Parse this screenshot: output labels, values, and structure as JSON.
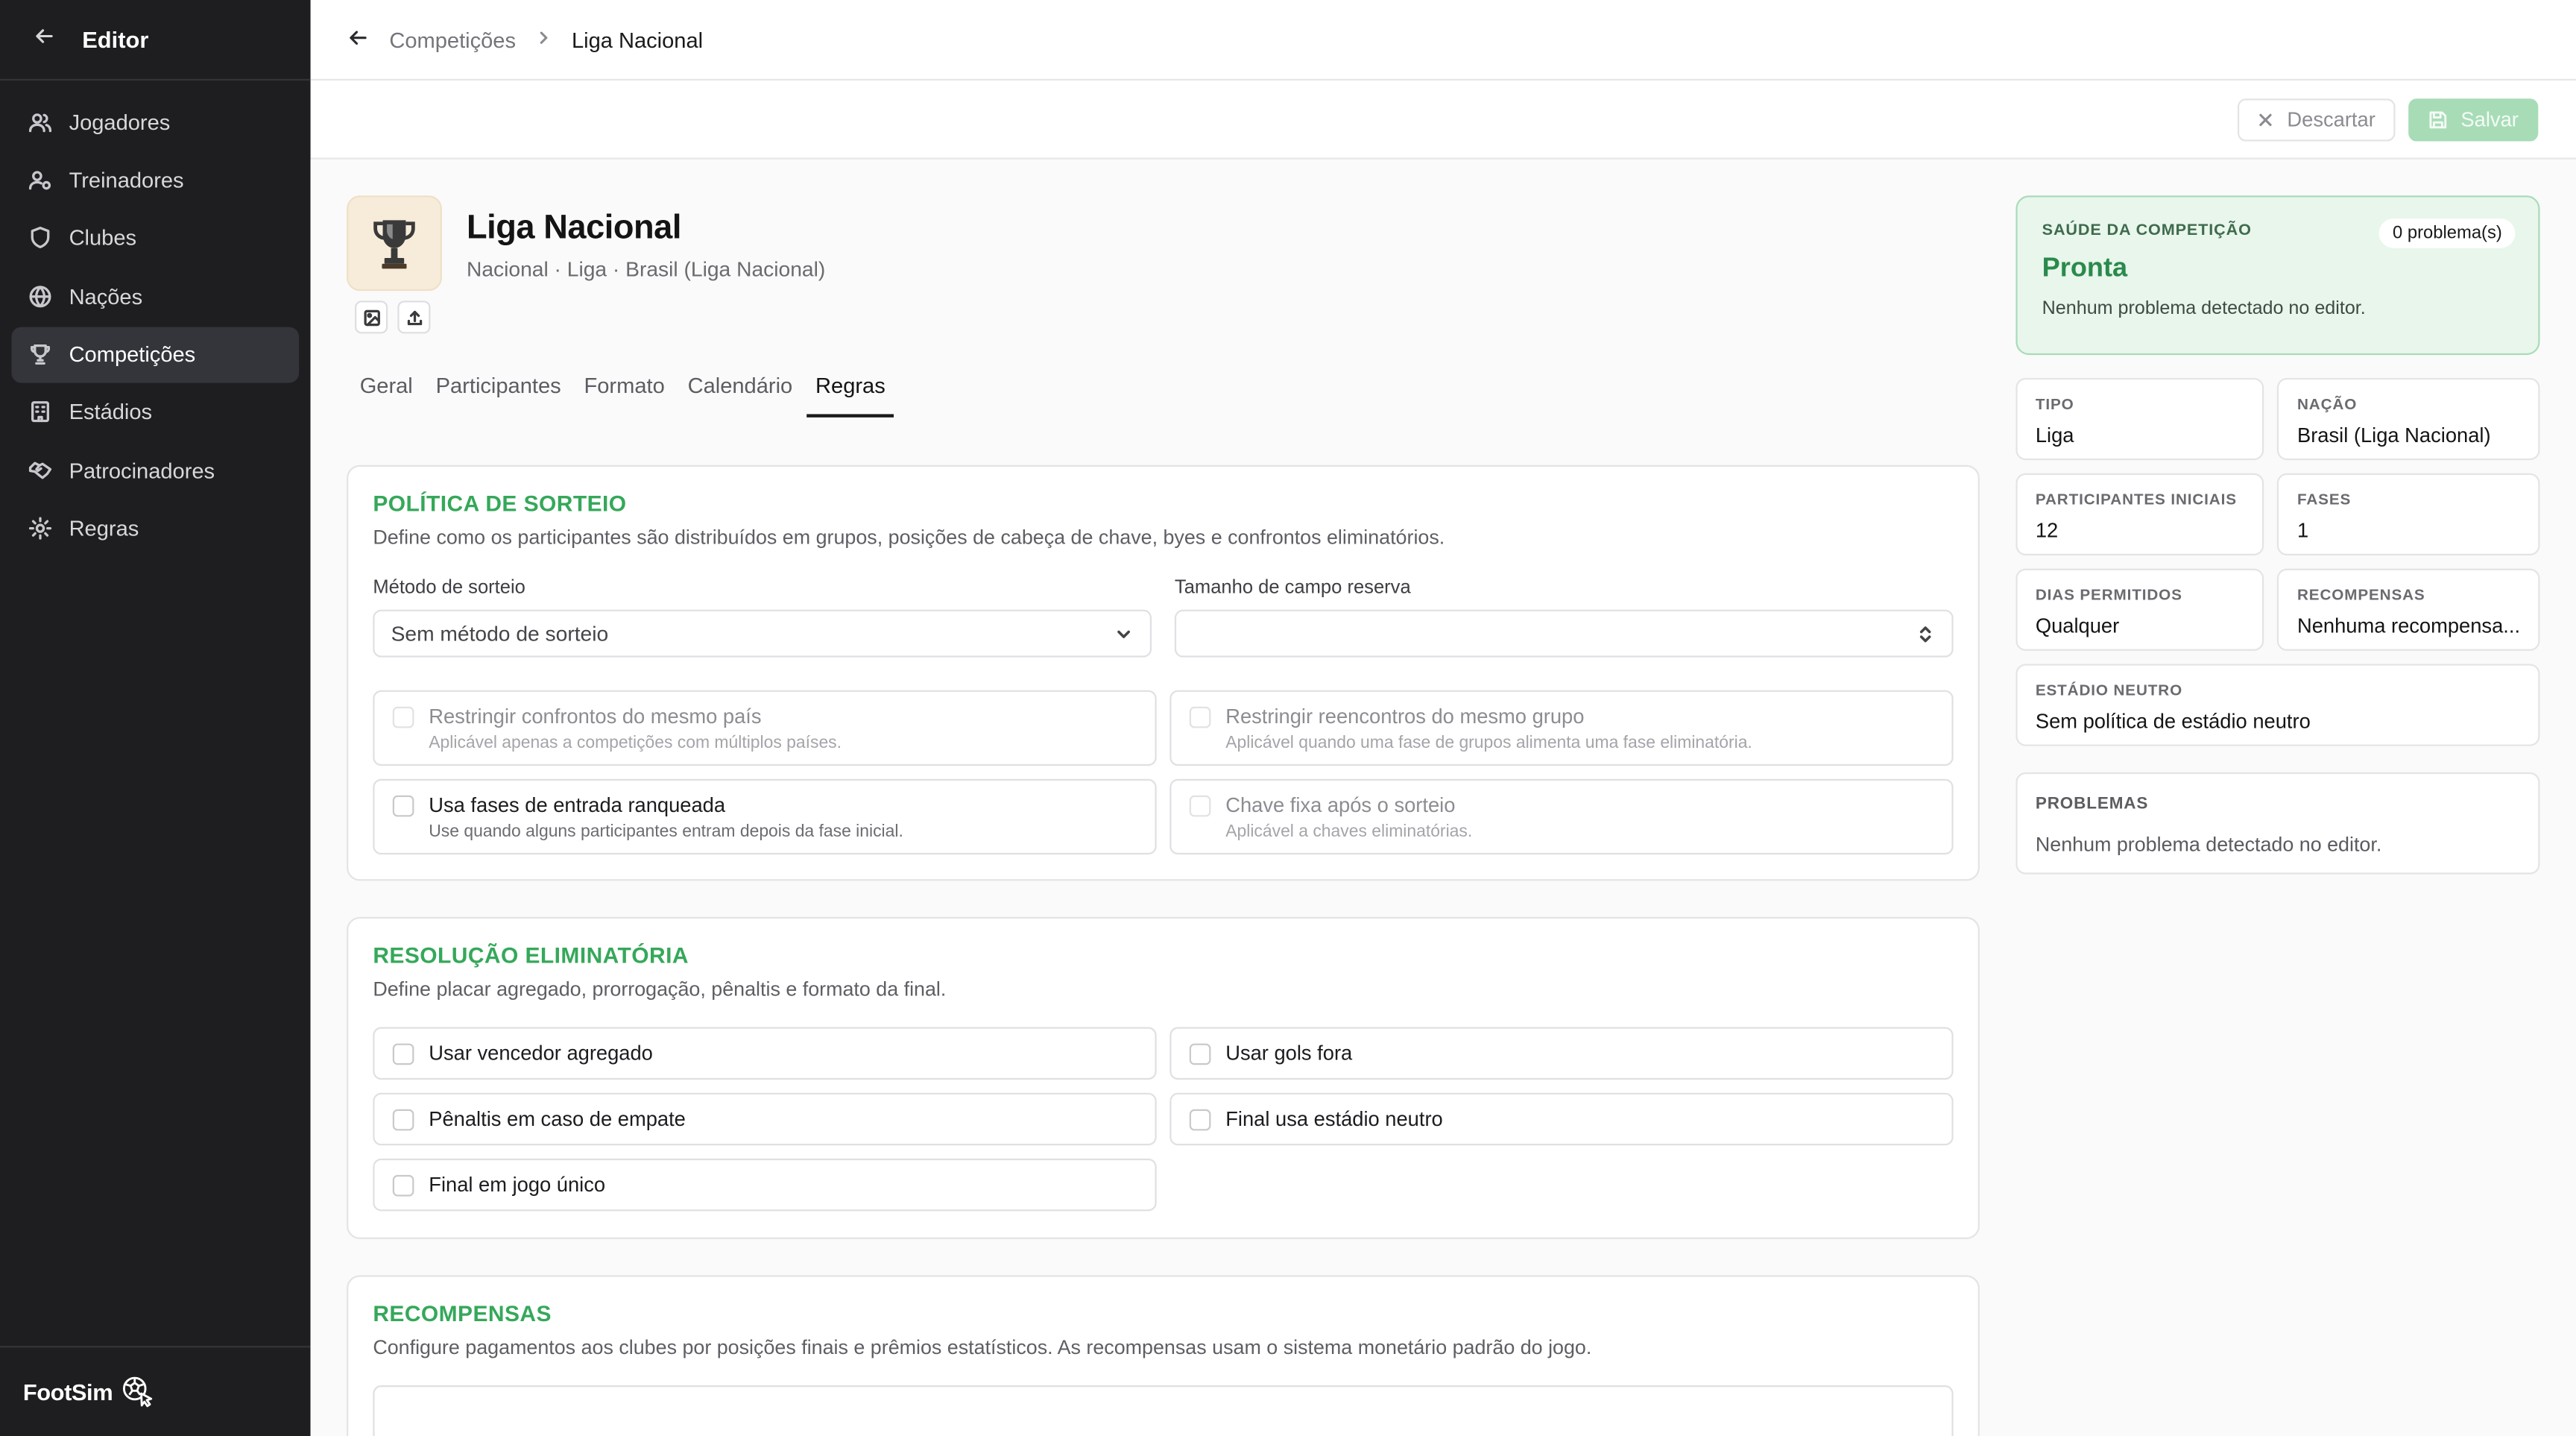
{
  "sidebar": {
    "title": "Editor",
    "items": [
      {
        "label": "Jogadores",
        "icon": "users-icon"
      },
      {
        "label": "Treinadores",
        "icon": "coach-icon"
      },
      {
        "label": "Clubes",
        "icon": "shield-icon"
      },
      {
        "label": "Nações",
        "icon": "globe-icon"
      },
      {
        "label": "Competições",
        "icon": "trophy-icon",
        "active": true
      },
      {
        "label": "Estádios",
        "icon": "stadium-icon"
      },
      {
        "label": "Patrocinadores",
        "icon": "handshake-icon"
      },
      {
        "label": "Regras",
        "icon": "gear-icon"
      }
    ],
    "brand": "FootSim"
  },
  "breadcrumb": {
    "parent": "Competições",
    "current": "Liga Nacional"
  },
  "actions": {
    "discard": "Descartar",
    "save": "Salvar"
  },
  "competition": {
    "name": "Liga Nacional",
    "subtitle": "Nacional · Liga · Brasil (Liga Nacional)"
  },
  "tabs": [
    {
      "label": "Geral"
    },
    {
      "label": "Participantes"
    },
    {
      "label": "Formato"
    },
    {
      "label": "Calendário"
    },
    {
      "label": "Regras",
      "active": true
    }
  ],
  "draw_policy": {
    "title": "POLÍTICA DE SORTEIO",
    "description": "Define como os participantes são distribuídos em grupos, posições de cabeça de chave, byes e confrontos eliminatórios.",
    "method_label": "Método de sorteio",
    "method_value": "Sem método de sorteio",
    "reserve_label": "Tamanho de campo reserva",
    "reserve_value": "",
    "options": [
      {
        "label": "Restringir confrontos do mesmo país",
        "hint": "Aplicável apenas a competições com múltiplos países.",
        "disabled": true
      },
      {
        "label": "Restringir reencontros do mesmo grupo",
        "hint": "Aplicável quando uma fase de grupos alimenta uma fase eliminatória.",
        "disabled": true
      },
      {
        "label": "Usa fases de entrada ranqueada",
        "hint": "Use quando alguns participantes entram depois da fase inicial.",
        "disabled": false
      },
      {
        "label": "Chave fixa após o sorteio",
        "hint": "Aplicável a chaves eliminatórias.",
        "disabled": true
      }
    ]
  },
  "knockout": {
    "title": "RESOLUÇÃO ELIMINATÓRIA",
    "description": "Define placar agregado, prorrogação, pênaltis e formato da final.",
    "options": [
      {
        "label": "Usar vencedor agregado"
      },
      {
        "label": "Usar gols fora"
      },
      {
        "label": "Pênaltis em caso de empate"
      },
      {
        "label": "Final usa estádio neutro"
      },
      {
        "label": "Final em jogo único"
      }
    ]
  },
  "rewards": {
    "title": "RECOMPENSAS",
    "description": "Configure pagamentos aos clubes por posições finais e prêmios estatísticos. As recompensas usam o sistema monetário padrão do jogo."
  },
  "health": {
    "kicker": "SAÚDE DA COMPETIÇÃO",
    "status": "Pronta",
    "message": "Nenhum problema detectado no editor.",
    "badge": "0 problema(s)"
  },
  "stats": [
    {
      "key": "TIPO",
      "value": "Liga"
    },
    {
      "key": "NAÇÃO",
      "value": "Brasil (Liga Nacional)"
    },
    {
      "key": "PARTICIPANTES INICIAIS",
      "value": "12"
    },
    {
      "key": "FASES",
      "value": "1"
    },
    {
      "key": "DIAS PERMITIDOS",
      "value": "Qualquer"
    },
    {
      "key": "RECOMPENSAS",
      "value": "Nenhuma recompensa..."
    },
    {
      "key": "ESTÁDIO NEUTRO",
      "value": "Sem política de estádio neutro"
    }
  ],
  "problems": {
    "title": "PROBLEMAS",
    "message": "Nenhum problema detectado no editor."
  },
  "colors": {
    "accent": "#35a85a",
    "sidebar_bg": "#1e1e20",
    "save_button": "#a7dcb7",
    "health_bg": "#e8f6ec"
  }
}
